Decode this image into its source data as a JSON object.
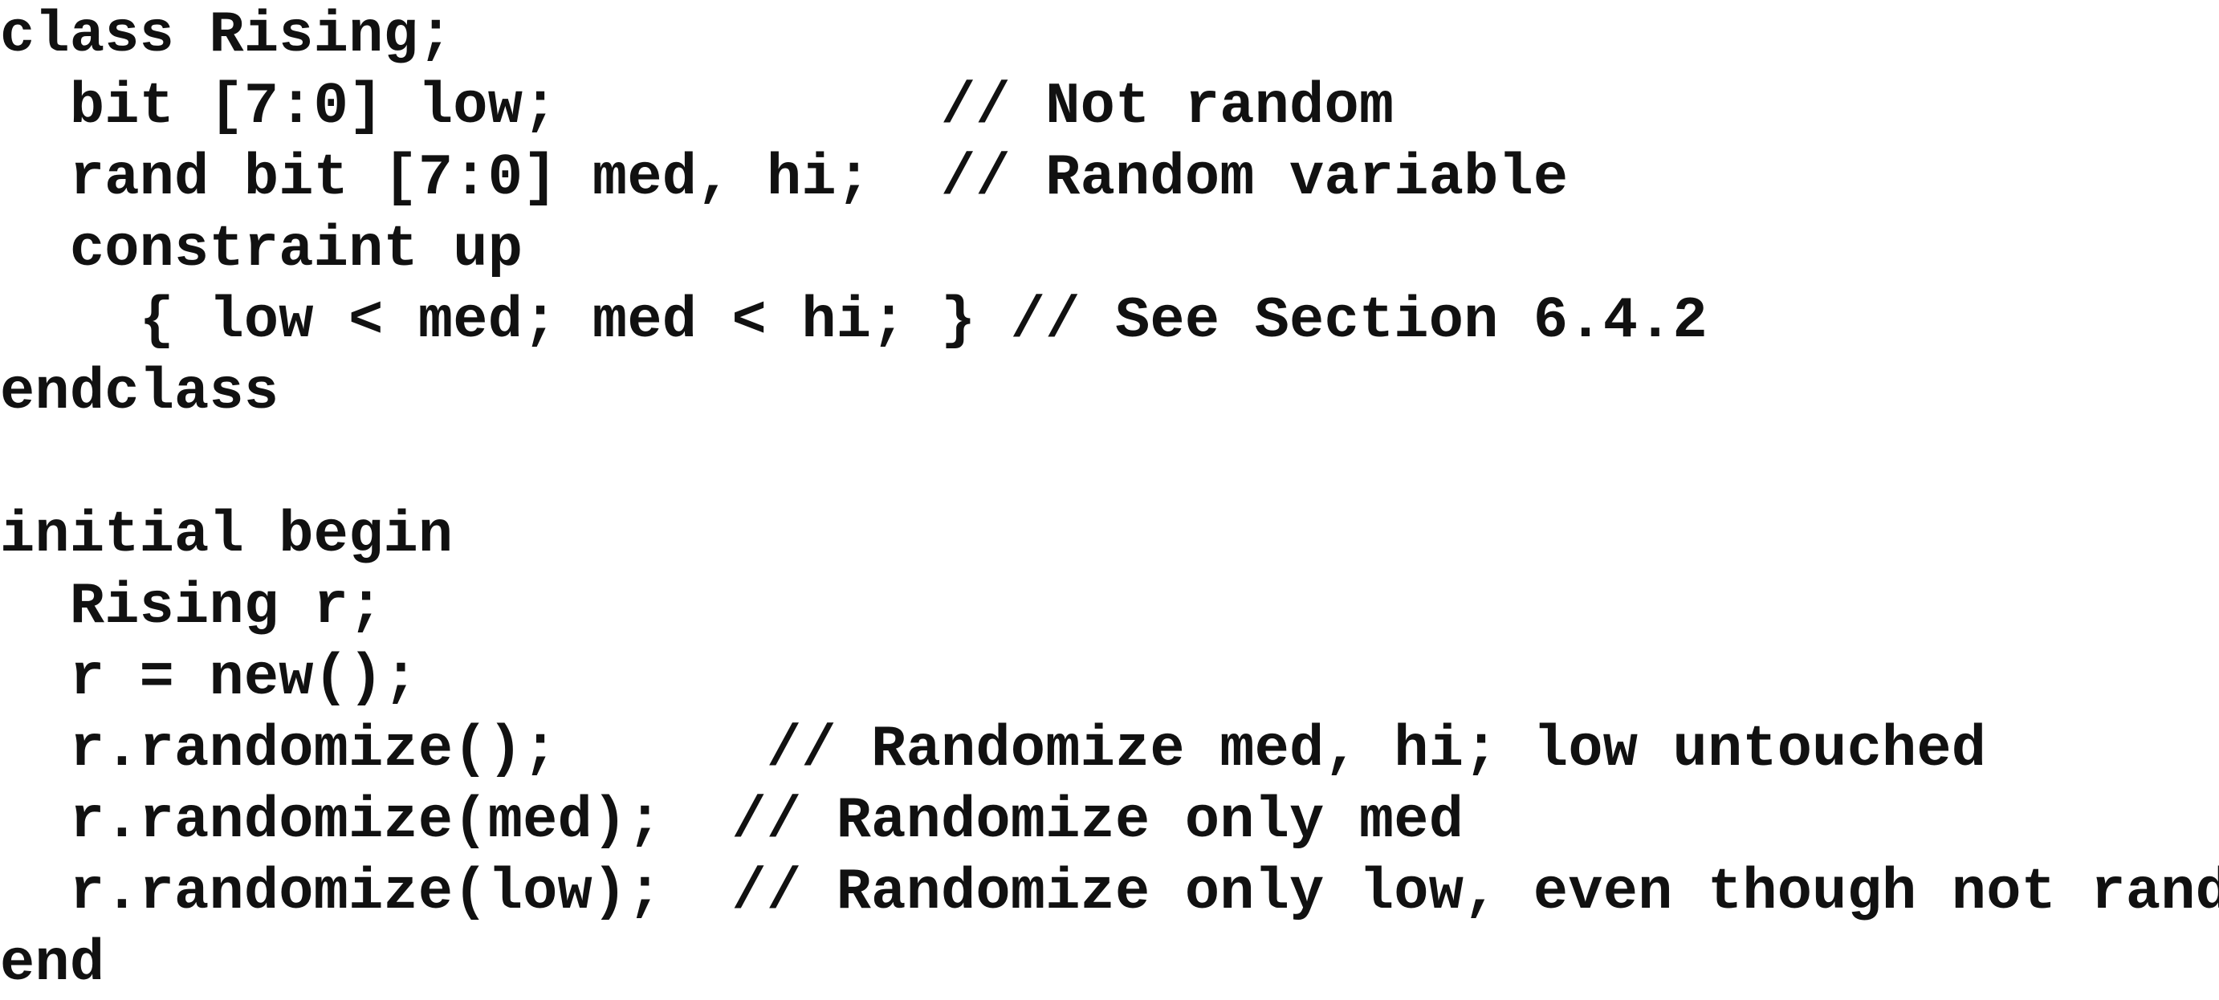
{
  "code": {
    "lines": [
      "class Rising;",
      "  bit [7:0] low;           // Not random",
      "  rand bit [7:0] med, hi;  // Random variable",
      "  constraint up",
      "    { low < med; med < hi; } // See Section 6.4.2",
      "endclass",
      "",
      "initial begin",
      "  Rising r;",
      "  r = new();",
      "  r.randomize();      // Randomize med, hi; low untouched",
      "  r.randomize(med);  // Randomize only med",
      "  r.randomize(low);  // Randomize only low, even though not rand",
      "end"
    ]
  }
}
